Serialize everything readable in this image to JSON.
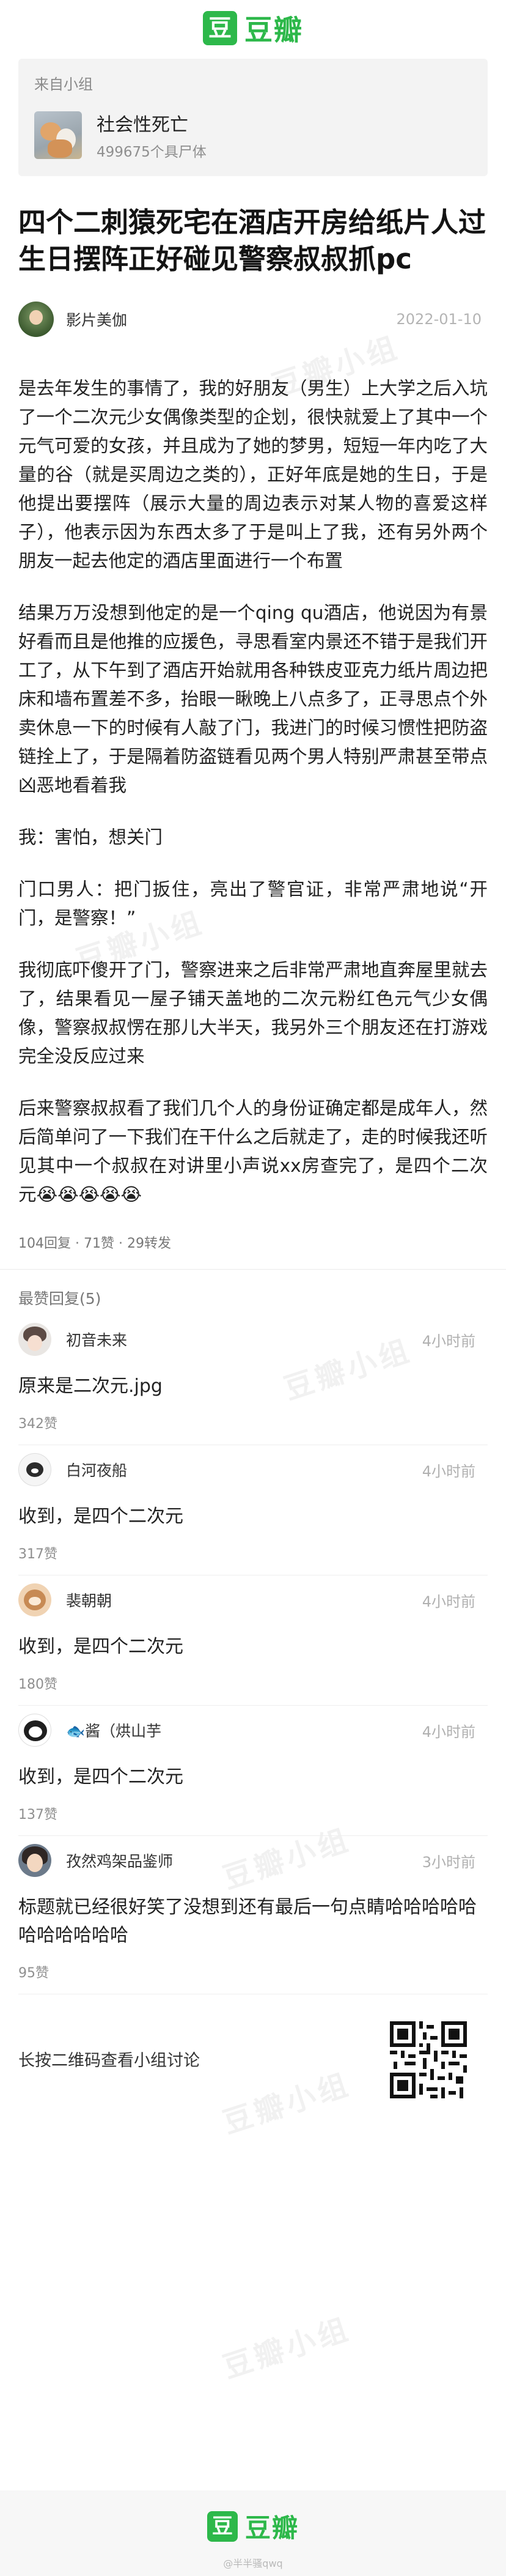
{
  "brand": {
    "logo_char": "豆",
    "name": "豆瓣"
  },
  "group": {
    "from_label": "来自小组",
    "name": "社会性死亡",
    "members": "499675个具尸体"
  },
  "post": {
    "title": "四个二刺猿死宅在酒店开房给纸片人过生日摆阵正好碰见警察叔叔抓pc",
    "author": "影片美伽",
    "date": "2022-01-10",
    "paragraphs": [
      "是去年发生的事情了，我的好朋友（男生）上大学之后入坑了一个二次元少女偶像类型的企划，很快就爱上了其中一个元气可爱的女孩，并且成为了她的梦男，短短一年内吃了大量的谷（就是买周边之类的），正好年底是她的生日，于是他提出要摆阵（展示大量的周边表示对某人物的喜爱这样子），他表示因为东西太多了于是叫上了我，还有另外两个朋友一起去他定的酒店里面进行一个布置",
      "结果万万没想到他定的是一个qing qu酒店，他说因为有景好看而且是他推的应援色，寻思看室内景还不错于是我们开工了，从下午到了酒店开始就用各种铁皮亚克力纸片周边把床和墙布置差不多，抬眼一瞅晚上八点多了，正寻思点个外卖休息一下的时候有人敲了门，我进门的时候习惯性把防盗链拴上了，于是隔着防盗链看见两个男人特别严肃甚至带点凶恶地看着我",
      "我：害怕，想关门",
      "门口男人：把门扳住，亮出了警官证，非常严肃地说“开门，是警察！”",
      "我彻底吓傻开了门，警察进来之后非常严肃地直奔屋里就去了，结果看见一屋子铺天盖地的二次元粉红色元气少女偶像，警察叔叔愣在那儿大半天，我另外三个朋友还在打游戏完全没反应过来",
      "后来警察叔叔看了我们几个人的身份证确定都是成年人，然后简单问了一下我们在干什么之后就走了，走的时候我还听见其中一个叔叔在对讲里小声说xx房查完了，是四个二次元😭😭😭😭😭"
    ],
    "stats": "104回复 · 71赞 · 29转发"
  },
  "comments_section": {
    "title": "最赞回复(5)",
    "items": [
      {
        "name": "初音未来",
        "time": "4小时前",
        "text": "原来是二次元.jpg",
        "likes": "342赞",
        "avatar": "anime-girl"
      },
      {
        "name": "白河夜船",
        "time": "4小时前",
        "text": "收到，是四个二次元",
        "likes": "317赞",
        "avatar": "black-cat"
      },
      {
        "name": "裴朝朝",
        "time": "4小时前",
        "text": "收到，是四个二次元",
        "likes": "180赞",
        "avatar": "shiba"
      },
      {
        "name": "🐟酱（烘山芋",
        "time": "4小时前",
        "text": "收到，是四个二次元",
        "likes": "137赞",
        "avatar": "penguin"
      },
      {
        "name": "孜然鸡架品鉴师",
        "time": "3小时前",
        "text": "标题就已经很好笑了没想到还有最后一句点睛哈哈哈哈哈哈哈哈哈哈哈",
        "likes": "95赞",
        "avatar": "anime-girl-dark"
      }
    ]
  },
  "qr": {
    "text": "长按二维码查看小组讨论"
  },
  "footer": {
    "credit": "@半半骚qwq"
  },
  "watermark": "豆瓣小组",
  "colors": {
    "brand_green": "#2db84a"
  }
}
